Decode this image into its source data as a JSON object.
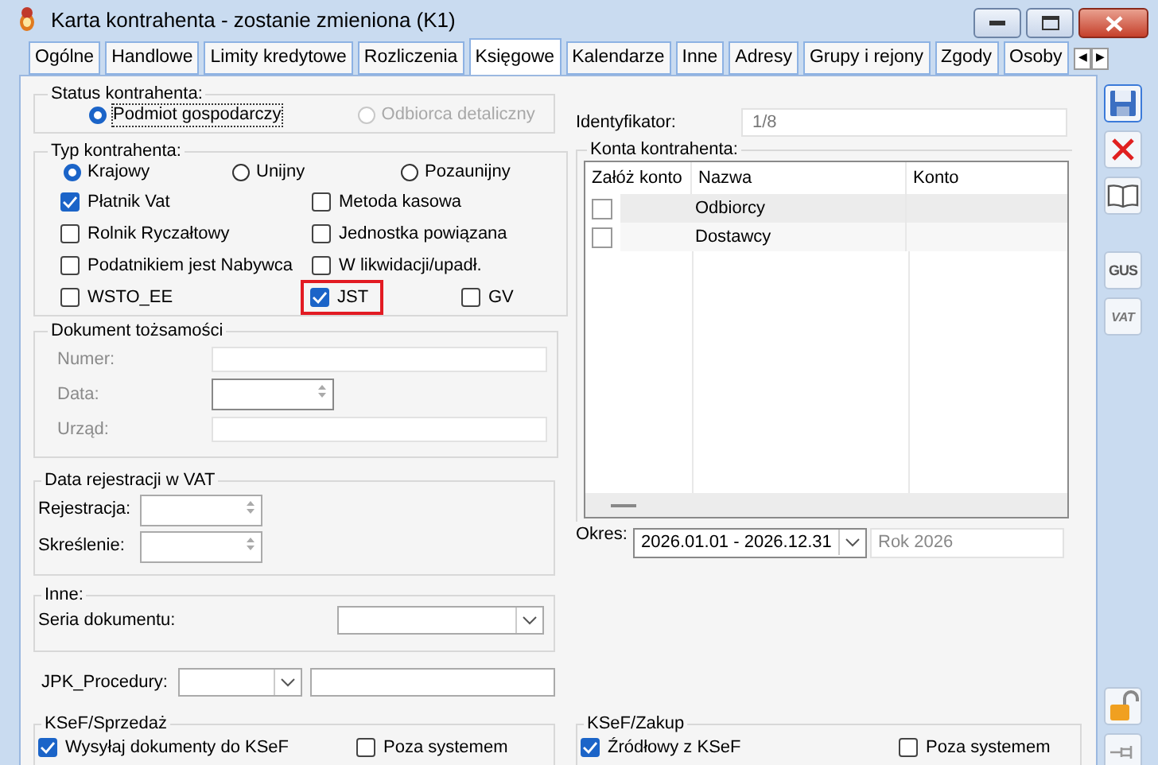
{
  "window": {
    "title": "Karta kontrahenta - zostanie zmieniona (K1)"
  },
  "tabs": [
    {
      "label": "Ogólne",
      "selected": false
    },
    {
      "label": "Handlowe",
      "selected": false
    },
    {
      "label": "Limity kredytowe",
      "selected": false
    },
    {
      "label": "Rozliczenia",
      "selected": false
    },
    {
      "label": "Księgowe",
      "selected": true
    },
    {
      "label": "Kalendarze",
      "selected": false
    },
    {
      "label": "Inne",
      "selected": false
    },
    {
      "label": "Adresy",
      "selected": false
    },
    {
      "label": "Grupy i rejony",
      "selected": false
    },
    {
      "label": "Zgody",
      "selected": false
    },
    {
      "label": "Osoby",
      "selected": false
    }
  ],
  "tab_scroll": [
    "◀",
    "▶"
  ],
  "status": {
    "label": "Status kontrahenta:",
    "options": [
      {
        "label": "Podmiot gospodarczy",
        "selected": true,
        "disabled": false
      },
      {
        "label": "Odbiorca detaliczny",
        "selected": false,
        "disabled": true
      }
    ]
  },
  "typ": {
    "label": "Typ kontrahenta:",
    "options": [
      {
        "label": "Krajowy",
        "selected": true
      },
      {
        "label": "Unijny",
        "selected": false
      },
      {
        "label": "Pozaunijny",
        "selected": false
      }
    ],
    "checkboxes": [
      {
        "label": "Płatnik Vat",
        "checked": true,
        "highlighted": false
      },
      {
        "label": "Metoda kasowa",
        "checked": false,
        "highlighted": false
      },
      {
        "label": "Rolnik Ryczałtowy",
        "checked": false,
        "highlighted": false
      },
      {
        "label": "Jednostka powiązana",
        "checked": false,
        "highlighted": false
      },
      {
        "label": "Podatnikiem jest Nabywca",
        "checked": false,
        "highlighted": false
      },
      {
        "label": "W likwidacji/upadł.",
        "checked": false,
        "highlighted": false
      },
      {
        "label": "WSTO_EE",
        "checked": false,
        "highlighted": false
      },
      {
        "label": "JST",
        "checked": true,
        "highlighted": true
      },
      {
        "label": "GV",
        "checked": false,
        "highlighted": false
      }
    ]
  },
  "dokument": {
    "label": "Dokument tożsamości",
    "disabled": true,
    "fields": [
      {
        "label": "Numer:",
        "kind": "text"
      },
      {
        "label": "Data:",
        "kind": "date"
      },
      {
        "label": "Urząd:",
        "kind": "text"
      }
    ]
  },
  "rejestracja": {
    "label": "Data rejestracji w VAT",
    "fields": [
      {
        "label": "Rejestracja:"
      },
      {
        "label": "Skreślenie:"
      }
    ]
  },
  "inne": {
    "label": "Inne:",
    "field_label": "Seria dokumentu:"
  },
  "jpk": {
    "label": "JPK_Procedury:"
  },
  "identyfikator": {
    "label": "Identyfikator:",
    "value": "1/8"
  },
  "konta": {
    "label": "Konta kontrahenta:",
    "columns": [
      "Załóż konto",
      "Nazwa",
      "Konto"
    ],
    "rows": [
      {
        "checked": false,
        "name": "Odbiorcy"
      },
      {
        "checked": false,
        "name": "Dostawcy"
      }
    ]
  },
  "okres": {
    "label": "Okres:",
    "value": "2026.01.01 - 2026.12.31",
    "period": "Rok 2026"
  },
  "ksef": [
    {
      "label": "KSeF/Sprzedaż",
      "checkboxes": [
        {
          "label": "Wysyłaj dokumenty do KSeF",
          "checked": true
        },
        {
          "label": "Poza systemem",
          "checked": false
        }
      ]
    },
    {
      "label": "KSeF/Zakup",
      "checkboxes": [
        {
          "label": "Źródłowy z KSeF",
          "checked": true
        },
        {
          "label": "Poza systemem",
          "checked": false
        }
      ]
    }
  ],
  "toolbar": [
    {
      "kind": "save"
    },
    {
      "kind": "cancel"
    },
    {
      "kind": "book"
    },
    {
      "kind": "gus",
      "label": "GUS"
    },
    {
      "kind": "vat",
      "label": "VAT"
    }
  ],
  "toolbar_bottom": [
    {
      "kind": "lock"
    },
    {
      "kind": "pin"
    }
  ]
}
